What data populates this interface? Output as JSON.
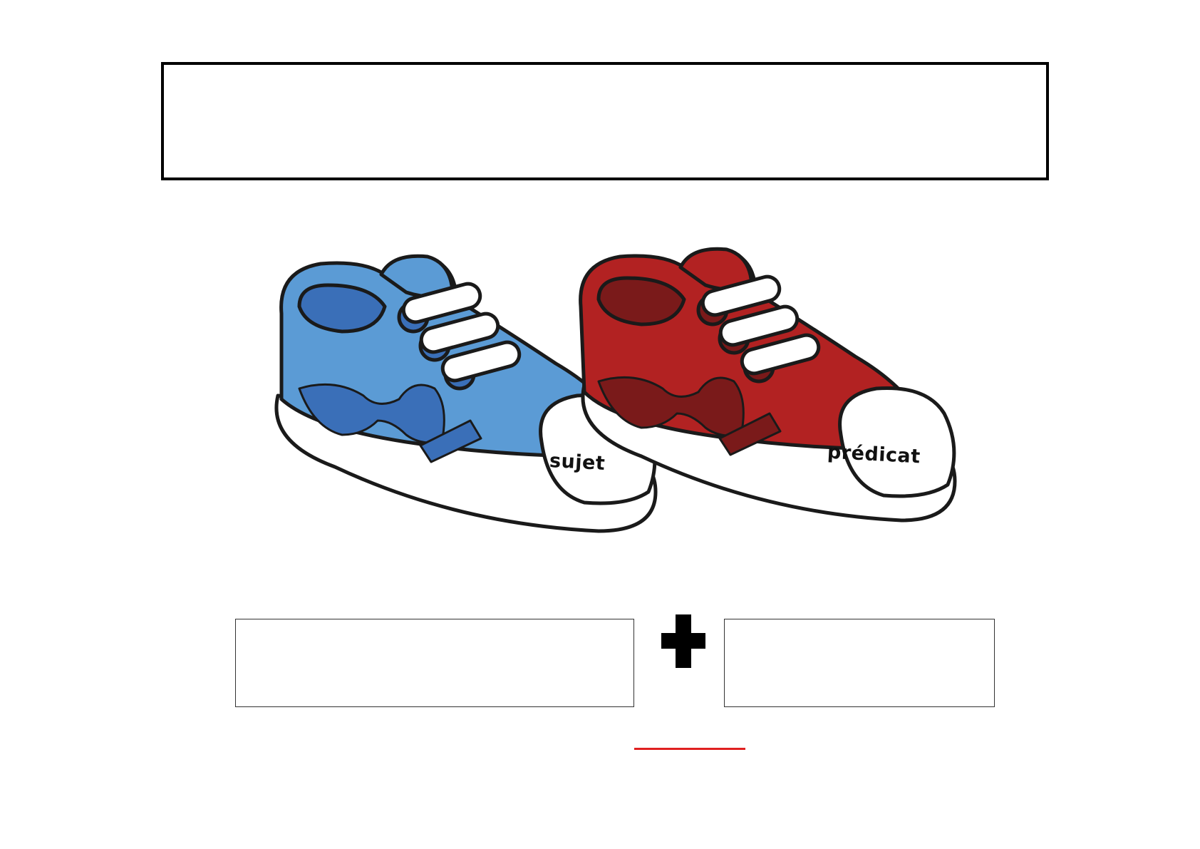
{
  "worksheet": {
    "title_box_text": "",
    "shoes": {
      "left_label": "sujet",
      "right_label": "prédicat",
      "left_color": "#5b9bd5",
      "right_color": "#b22222"
    },
    "answer_left": "",
    "answer_right": "",
    "operator": "plus-icon",
    "underline_color": "#e02020"
  }
}
